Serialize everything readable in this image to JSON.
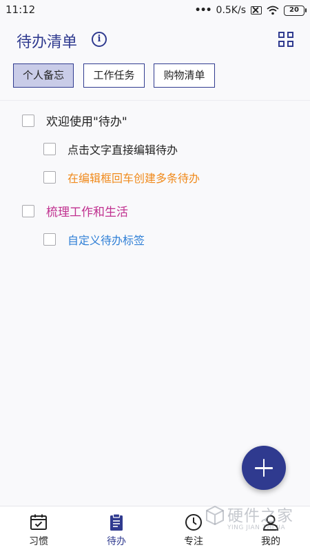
{
  "status_bar": {
    "time": "11:12",
    "dots": "•••",
    "network_speed": "0.5K/s",
    "battery": "20"
  },
  "header": {
    "title": "待办清单",
    "info_icon": "info-icon",
    "view_icon": "grid-view-icon"
  },
  "tabs": [
    {
      "label": "个人备忘",
      "active": true
    },
    {
      "label": "工作任务",
      "active": false
    },
    {
      "label": "购物清单",
      "active": false
    }
  ],
  "todos": [
    {
      "text": "欢迎使用\"待办\"",
      "level": 0,
      "checked": false,
      "color": "#222222"
    },
    {
      "text": "点击文字直接编辑待办",
      "level": 1,
      "checked": false,
      "color": "#222222"
    },
    {
      "text": "在编辑框回车创建多条待办",
      "level": 1,
      "checked": false,
      "color": "#f08a1c"
    },
    {
      "text": "梳理工作和生活",
      "level": 0,
      "checked": false,
      "color": "#c0308f"
    },
    {
      "text": "自定义待办标签",
      "level": 1,
      "checked": false,
      "color": "#2f7fd6"
    }
  ],
  "fab": {
    "icon": "plus-icon"
  },
  "bottom_nav": [
    {
      "label": "习惯",
      "icon": "calendar-check-icon",
      "active": false
    },
    {
      "label": "待办",
      "icon": "clipboard-icon",
      "active": true
    },
    {
      "label": "专注",
      "icon": "clock-icon",
      "active": false
    },
    {
      "label": "我的",
      "icon": "user-icon",
      "active": false
    }
  ],
  "watermark": {
    "title": "硬件之家",
    "subtitle": "YING JIAN ZHI JIA"
  },
  "colors": {
    "accent": "#2f3a8f",
    "tab_active_bg": "#c9cce8",
    "background": "#f9f9fb"
  }
}
